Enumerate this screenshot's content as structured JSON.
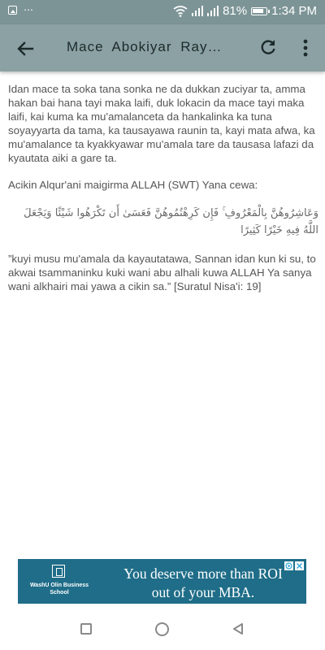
{
  "status_bar": {
    "battery_percent": "81%",
    "time": "1:34 PM",
    "icons": [
      "image-icon",
      "more-dots-icon",
      "wifi-icon",
      "signal-icon",
      "signal-icon",
      "battery-icon"
    ]
  },
  "app_bar": {
    "title": "Mace  Abokiyar  Ray…",
    "back_icon": "arrow-back-icon",
    "refresh_icon": "refresh-icon",
    "more_icon": "more-vertical-icon",
    "background": "#8ba1a3"
  },
  "content": {
    "paragraph_1": "Idan mace ta soka tana sonka ne da dukkan zuciyar ta, amma hakan bai hana tayi maka laifi, duk lokacin da mace tayi maka laifi, kai kuma ka mu'amalanceta da hankalinka ka tuna soyayyarta da tama, ka tausayawa  raunin ta, kayi mata afwa, ka mu'amalance ta kyakkyawar mu'amala tare da tausasa lafazi da kyautata aiki a gare ta.",
    "paragraph_2": "Acikin Alqur'ani maigirma ALLAH (SWT) Yana cewa:",
    "arabic_verse": "وَعَاشِرُوهُنَّ بِالْمَعْرُوفِ ۚ فَإِن كَرِهْتُمُوهُنَّ فَعَسَىٰ أَن تَكْرَهُوا شَيْئًا وَيَجْعَلَ اللَّهُ فِيهِ خَيْرًا كَثِيرًا",
    "paragraph_3": "”kuyi musu mu'amala da kayautatawa, Sannan idan kun ki su, to akwai tsammaninku kuki wani abu alhali kuwa ALLAH Ya sanya wani alkhairi mai yawa a cikin sa.” [Suratul Nisa'i: 19]"
  },
  "ad": {
    "school_name": "WashU Olin Business School",
    "headline": "You deserve more than ROI out of your MBA.",
    "background": "#1f6d88",
    "adchoices_icon": "adchoices-icon",
    "close_icon": "close-icon"
  },
  "nav_bar": {
    "icons": [
      "recents-square-icon",
      "home-circle-icon",
      "back-triangle-icon"
    ]
  }
}
